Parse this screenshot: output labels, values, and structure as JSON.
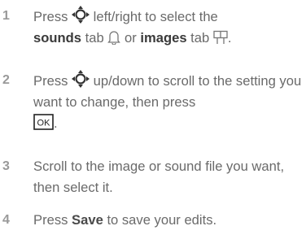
{
  "steps": [
    {
      "number": "1",
      "t1": "Press",
      "t2": "left/right to select the",
      "t3": "sounds",
      "t4": "tab",
      "t5": "or",
      "t6": "images",
      "t7": "tab",
      "t8": ".",
      "icons": [
        "navigation-key-icon",
        "bell-icon",
        "picture-frame-icon"
      ]
    },
    {
      "number": "2",
      "t1": "Press",
      "t2": "up/down to scroll to the setting you want to change, then press",
      "key_label": "OK",
      "t3": ".",
      "icons": [
        "navigation-key-icon",
        "ok-key-icon"
      ]
    },
    {
      "number": "3",
      "text": "Scroll to the image or sound file you want, then select it."
    },
    {
      "number": "4",
      "t1": "Press",
      "key": "Save",
      "t2": "to save your edits."
    }
  ]
}
